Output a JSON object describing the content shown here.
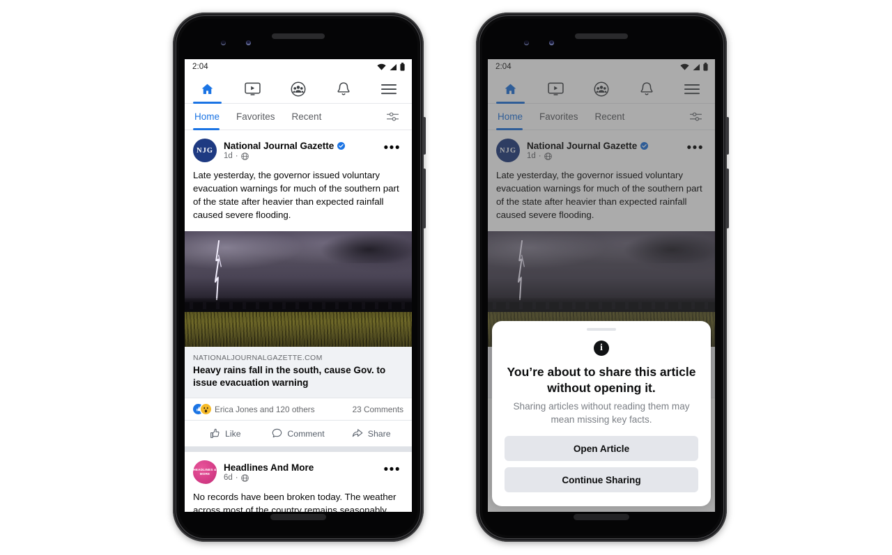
{
  "status_bar": {
    "time": "2:04",
    "icons": [
      "wifi-icon",
      "cellular-signal-icon",
      "battery-icon"
    ]
  },
  "top_nav": {
    "items": [
      {
        "name": "home",
        "icon": "home-icon",
        "active": true
      },
      {
        "name": "watch",
        "icon": "video-icon",
        "active": false
      },
      {
        "name": "groups",
        "icon": "groups-icon",
        "active": false
      },
      {
        "name": "notifications",
        "icon": "bell-icon",
        "active": false
      },
      {
        "name": "menu",
        "icon": "hamburger-menu-icon",
        "active": false
      }
    ]
  },
  "sub_tabs": {
    "items": [
      {
        "label": "Home",
        "active": true
      },
      {
        "label": "Favorites",
        "active": false
      },
      {
        "label": "Recent",
        "active": false
      }
    ],
    "filter_icon": "sliders-filter-icon"
  },
  "posts": [
    {
      "avatar_initials": "NJG",
      "author": "National Journal Gazette",
      "verified": true,
      "time": "1d",
      "audience_icon": "globe-icon",
      "menu_icon": "ellipsis-icon",
      "body": "Late yesterday, the governor issued voluntary evacuation warnings for much of the southern part of the state after heavier than expected rainfall caused severe flooding.",
      "image_alt": "lightning-storm-over-field-photo",
      "link_preview": {
        "domain": "NATIONALJOURNALGAZETTE.COM",
        "title": "Heavy rains fall in the south, cause Gov. to issue evacuation warning"
      },
      "reactions_text": "Erica Jones and 120 others",
      "comments_text": "23 Comments",
      "actions": [
        {
          "label": "Like",
          "icon": "thumbs-up-icon"
        },
        {
          "label": "Comment",
          "icon": "comment-bubble-icon"
        },
        {
          "label": "Share",
          "icon": "share-arrow-icon"
        }
      ]
    },
    {
      "avatar_initials": "HEADLINES & MORE",
      "author": "Headlines And More",
      "verified": false,
      "time": "6d",
      "audience_icon": "globe-icon",
      "menu_icon": "ellipsis-icon",
      "body": "No records have been broken today. The weather across most of the country remains seasonably"
    }
  ],
  "share_dialog": {
    "handle": "drag-handle",
    "icon": "info-icon",
    "title": "You’re about to share this article without opening it.",
    "subtitle": "Sharing articles without reading them may mean missing key facts.",
    "primary_button": "Open Article",
    "secondary_button": "Continue Sharing"
  },
  "colors": {
    "brand_blue": "#1b74e4",
    "text_primary": "#050505",
    "text_secondary": "#65676b",
    "surface": "#ffffff",
    "card_gray": "#f0f2f5",
    "button_gray": "#e4e6eb",
    "avatar_navy": "#1e3a82",
    "avatar_pink": "#d9418b"
  }
}
